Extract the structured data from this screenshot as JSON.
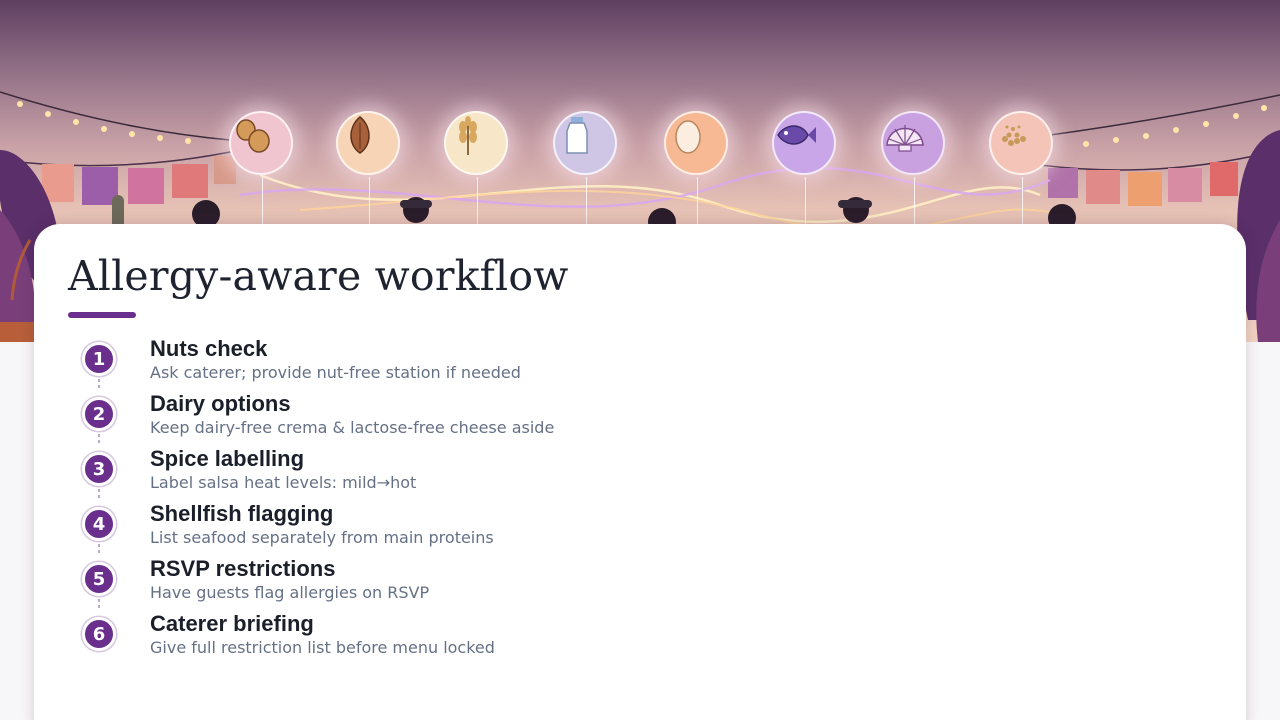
{
  "slide": {
    "title": "Allergy-aware workflow",
    "accent_color": "#6a2f8c"
  },
  "hero": {
    "allergen_icons": [
      "peanut-icon",
      "almond-icon",
      "wheat-icon",
      "milk-bottle-icon",
      "egg-icon",
      "fish-icon",
      "shell-icon",
      "seeds-icon"
    ]
  },
  "steps": [
    {
      "number": "1",
      "title": "Nuts check",
      "desc": "Ask caterer; provide nut-free station if needed"
    },
    {
      "number": "2",
      "title": "Dairy options",
      "desc": "Keep dairy-free crema & lactose-free cheese aside"
    },
    {
      "number": "3",
      "title": "Spice labelling",
      "desc": "Label salsa heat levels: mild→hot"
    },
    {
      "number": "4",
      "title": "Shellfish flagging",
      "desc": "List seafood separately from main proteins"
    },
    {
      "number": "5",
      "title": "RSVP restrictions",
      "desc": "Have guests flag allergies on RSVP"
    },
    {
      "number": "6",
      "title": "Caterer briefing",
      "desc": "Give full restriction list before menu locked"
    }
  ]
}
